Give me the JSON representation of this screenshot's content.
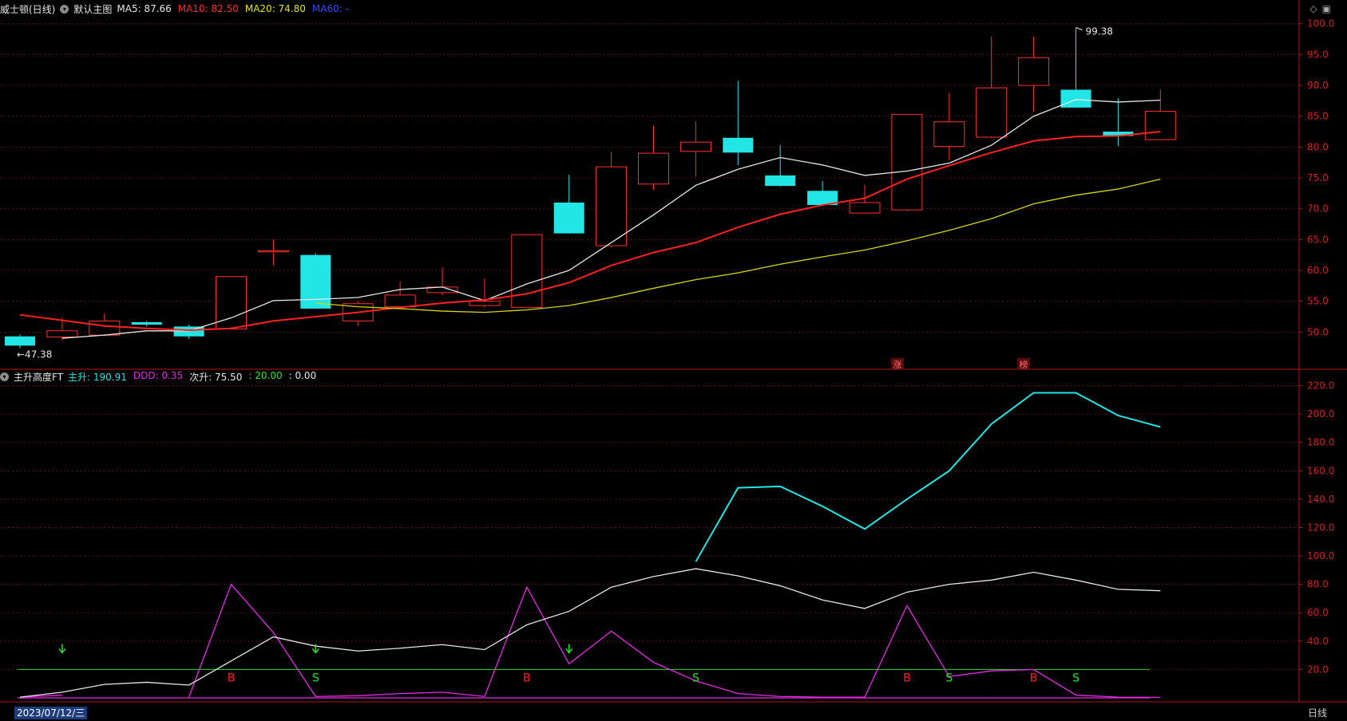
{
  "header_top": {
    "stock_name": "威士顿(日线)",
    "template": "默认主图",
    "ma_items": [
      {
        "label": "MA5: 87.66",
        "color": "#e6e6e6"
      },
      {
        "label": "MA10: 82.50",
        "color": "#ff2d2d"
      },
      {
        "label": "MA20: 74.80",
        "color": "#e6e600"
      },
      {
        "label": "MA60: -",
        "color": "#2b4bff"
      }
    ]
  },
  "header_bottom": {
    "indicator_name": "主升高度FT",
    "items": [
      {
        "label": "主升: 190.91",
        "color": "#22e6e6"
      },
      {
        "label": "DDD: 0.35",
        "color": "#e629e6"
      },
      {
        "label": "次升: 75.50",
        "color": "#e6e6e6"
      },
      {
        "label": ": 20.00",
        "color": "#22e622"
      },
      {
        "label": ": 0.00",
        "color": "#e6e6e6"
      }
    ]
  },
  "footer": {
    "date": "2023/07/12/三",
    "period": "日线"
  },
  "chart_data": [
    {
      "type": "candlestick",
      "ylim": [
        45,
        101
      ],
      "y_ticks": [
        "100.0",
        "95.0",
        "90.0",
        "85.0",
        "80.0",
        "75.0",
        "70.0",
        "65.0",
        "60.0",
        "55.0",
        "50.0"
      ],
      "annotations": [
        {
          "text": "99.38",
          "index": 25,
          "value": 99.38
        },
        {
          "text": "47.38",
          "index": 0,
          "value": 47.38
        }
      ],
      "markers": [
        "涨",
        "榜"
      ],
      "candles": [
        {
          "o": 49.3,
          "h": 49.6,
          "l": 47.38,
          "c": 47.8
        },
        {
          "o": 49.2,
          "h": 52.3,
          "l": 48.7,
          "c": 50.2
        },
        {
          "o": 49.5,
          "h": 53.0,
          "l": 49.3,
          "c": 51.8
        },
        {
          "o": 51.6,
          "h": 51.8,
          "l": 50.9,
          "c": 51.2
        },
        {
          "o": 50.9,
          "h": 51.2,
          "l": 48.9,
          "c": 49.3
        },
        {
          "o": 50.5,
          "h": 59.0,
          "l": 50.4,
          "c": 59.0
        },
        {
          "o": 63.2,
          "h": 65.0,
          "l": 60.8,
          "c": 63.2
        },
        {
          "o": 62.5,
          "h": 62.8,
          "l": 53.8,
          "c": 53.8
        },
        {
          "o": 51.8,
          "h": 55.0,
          "l": 51.0,
          "c": 54.6
        },
        {
          "o": 54.1,
          "h": 58.2,
          "l": 53.8,
          "c": 56.0
        },
        {
          "o": 56.4,
          "h": 60.5,
          "l": 56.0,
          "c": 57.3
        },
        {
          "o": 54.3,
          "h": 58.7,
          "l": 54.0,
          "c": 55.0
        },
        {
          "o": 54.0,
          "h": 65.8,
          "l": 53.9,
          "c": 65.8
        },
        {
          "o": 71.0,
          "h": 75.5,
          "l": 66.0,
          "c": 66.0
        },
        {
          "o": 64.0,
          "h": 79.2,
          "l": 63.7,
          "c": 76.8
        },
        {
          "o": 74.0,
          "h": 83.5,
          "l": 73.0,
          "c": 79.0
        },
        {
          "o": 79.3,
          "h": 84.2,
          "l": 75.2,
          "c": 80.8
        },
        {
          "o": 81.5,
          "h": 90.7,
          "l": 77.1,
          "c": 79.1
        },
        {
          "o": 75.4,
          "h": 80.3,
          "l": 73.6,
          "c": 73.7
        },
        {
          "o": 72.9,
          "h": 74.5,
          "l": 70.6,
          "c": 70.6
        },
        {
          "o": 69.3,
          "h": 73.9,
          "l": 69.2,
          "c": 71.0
        },
        {
          "o": 69.8,
          "h": 85.3,
          "l": 69.6,
          "c": 85.3
        },
        {
          "o": 80.1,
          "h": 88.8,
          "l": 77.9,
          "c": 84.1
        },
        {
          "o": 81.6,
          "h": 97.9,
          "l": 81.4,
          "c": 89.6
        },
        {
          "o": 90.0,
          "h": 97.9,
          "l": 85.7,
          "c": 94.5
        },
        {
          "o": 89.3,
          "h": 99.38,
          "l": 86.4,
          "c": 86.4
        },
        {
          "o": 82.5,
          "h": 87.9,
          "l": 80.2,
          "c": 81.8
        },
        {
          "o": 81.2,
          "h": 89.3,
          "l": 81.2,
          "c": 85.8
        }
      ],
      "series": [
        {
          "name": "MA5",
          "color": "#e6e6e6",
          "values": [
            null,
            49.0,
            49.5,
            50.2,
            50.2,
            52.3,
            55.1,
            55.3,
            55.6,
            56.9,
            57.3,
            55.1,
            57.8,
            60.0,
            64.5,
            69.0,
            73.8,
            76.4,
            78.3,
            77.1,
            75.4,
            76.1,
            77.4,
            80.3,
            85.0,
            87.7,
            87.3,
            87.6
          ]
        },
        {
          "name": "MA10",
          "color": "#ff2020",
          "values": [
            52.8,
            51.9,
            51.0,
            50.6,
            50.3,
            50.6,
            51.8,
            52.5,
            53.2,
            54.0,
            54.7,
            55.2,
            56.2,
            58.0,
            60.8,
            62.9,
            64.5,
            67.0,
            69.1,
            70.6,
            71.7,
            74.8,
            77.0,
            79.1,
            81.0,
            81.7,
            81.8,
            82.5
          ]
        },
        {
          "name": "MA20",
          "color": "#d6d60c",
          "values": [
            null,
            null,
            null,
            null,
            null,
            null,
            null,
            54.7,
            54.1,
            53.8,
            53.4,
            53.2,
            53.6,
            54.3,
            55.6,
            57.1,
            58.5,
            59.6,
            61.0,
            62.2,
            63.3,
            64.8,
            66.5,
            68.4,
            70.8,
            72.2,
            73.2,
            74.8
          ]
        }
      ]
    },
    {
      "type": "line",
      "ylim": [
        0,
        222
      ],
      "y_ticks": [
        "220.0",
        "200.0",
        "180.0",
        "160.0",
        "140.0",
        "120.0",
        "100.0",
        "80.0",
        "60.0",
        "40.0",
        "20.0"
      ],
      "threshold_lines": [
        {
          "value": 20,
          "color": "#22c822"
        },
        {
          "value": 0,
          "color": "#e629e6"
        }
      ],
      "signals": [
        {
          "index": 1,
          "kind": "down-arrow"
        },
        {
          "index": 5,
          "kind": "B"
        },
        {
          "index": 7,
          "kind": "S"
        },
        {
          "index": 7,
          "kind": "down-arrow"
        },
        {
          "index": 12,
          "kind": "B"
        },
        {
          "index": 13,
          "kind": "down-arrow"
        },
        {
          "index": 16,
          "kind": "S"
        },
        {
          "index": 21,
          "kind": "B"
        },
        {
          "index": 22,
          "kind": "S"
        },
        {
          "index": 24,
          "kind": "B"
        },
        {
          "index": 25,
          "kind": "S"
        }
      ],
      "series": [
        {
          "name": "主升",
          "color": "#22e6e6",
          "values": [
            null,
            null,
            null,
            null,
            null,
            null,
            null,
            null,
            null,
            null,
            null,
            null,
            null,
            null,
            null,
            null,
            96,
            148,
            149,
            135,
            119,
            140,
            160,
            193,
            215,
            215,
            199,
            190.91
          ]
        },
        {
          "name": "DDD",
          "color": "#e629e6",
          "values": [
            0.5,
            2,
            null,
            null,
            0.5,
            80,
            46,
            1,
            1.5,
            3,
            4,
            1,
            78,
            24,
            47,
            25,
            12,
            3,
            1,
            0.5,
            0.5,
            65,
            15,
            19,
            20,
            2,
            0.5,
            0.35
          ]
        },
        {
          "name": "次升",
          "color": "#e6e6e6",
          "values": [
            0.5,
            4,
            9.5,
            11,
            9,
            26,
            43,
            36.5,
            33,
            35,
            37.5,
            34,
            51.5,
            61,
            78,
            85.5,
            91,
            86,
            79,
            69,
            63,
            74.5,
            80,
            83,
            88.5,
            83,
            76.5,
            75.5
          ]
        }
      ]
    }
  ]
}
